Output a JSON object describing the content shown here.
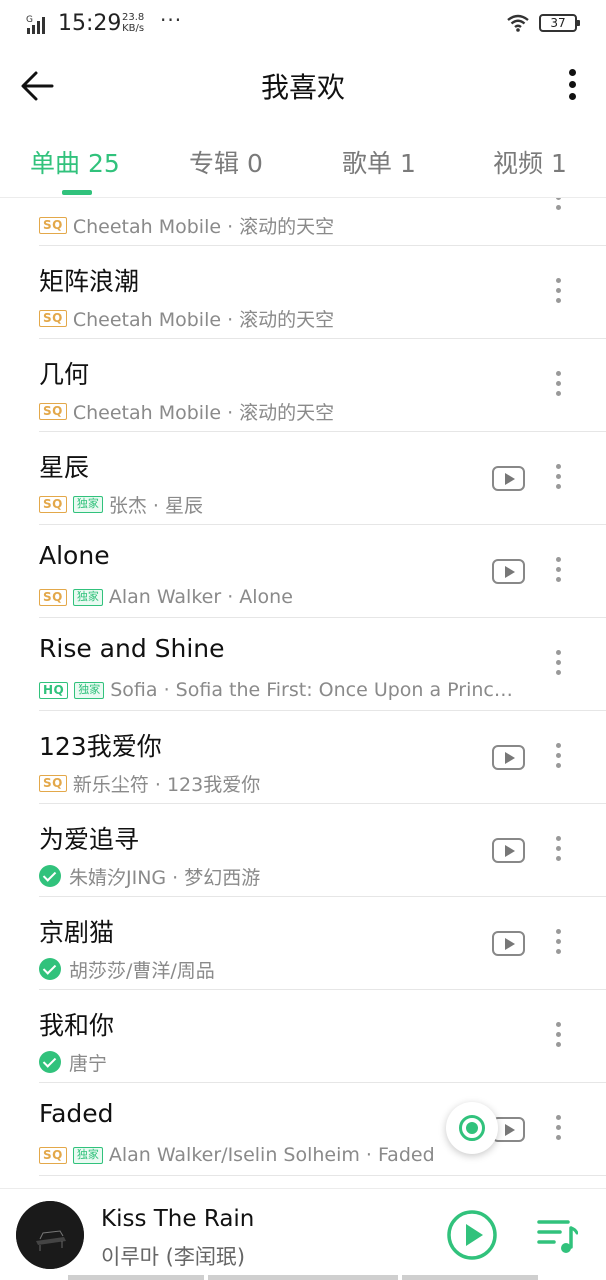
{
  "status_bar": {
    "time": "15:29",
    "network_speed_value": "23.8",
    "network_speed_unit": "KB/s",
    "signal_type": "G",
    "battery": "37",
    "extra": "···"
  },
  "header": {
    "title": "我喜欢"
  },
  "tabs": [
    {
      "label": "单曲 25",
      "active": true
    },
    {
      "label": "专辑 0",
      "active": false
    },
    {
      "label": "歌单 1",
      "active": false
    },
    {
      "label": "视频 1",
      "active": false
    }
  ],
  "songs": [
    {
      "title": "",
      "quality": "SQ",
      "exclusive": false,
      "downloaded": false,
      "sub": "Cheetah Mobile · 滚动的天空",
      "mv": false
    },
    {
      "title": "矩阵浪潮",
      "quality": "SQ",
      "exclusive": false,
      "downloaded": false,
      "sub": "Cheetah Mobile · 滚动的天空",
      "mv": false
    },
    {
      "title": "几何",
      "quality": "SQ",
      "exclusive": false,
      "downloaded": false,
      "sub": "Cheetah Mobile · 滚动的天空",
      "mv": false
    },
    {
      "title": "星辰",
      "quality": "SQ",
      "exclusive": true,
      "downloaded": false,
      "sub": "张杰 · 星辰",
      "mv": true
    },
    {
      "title": "Alone",
      "quality": "SQ",
      "exclusive": true,
      "downloaded": false,
      "sub": "Alan Walker · Alone",
      "mv": true
    },
    {
      "title": "Rise and Shine",
      "quality": "HQ",
      "exclusive": true,
      "downloaded": false,
      "sub": "Sofia · Sofia the First: Once Upon a Princ…",
      "mv": false
    },
    {
      "title": "123我爱你",
      "quality": "SQ",
      "exclusive": false,
      "downloaded": false,
      "sub": "新乐尘符 · 123我爱你",
      "mv": true
    },
    {
      "title": "为爱追寻",
      "quality": "",
      "exclusive": false,
      "downloaded": true,
      "sub": "朱婧汐JING · 梦幻西游",
      "mv": true
    },
    {
      "title": "京剧猫",
      "quality": "",
      "exclusive": false,
      "downloaded": true,
      "sub": "胡莎莎/曹洋/周品",
      "mv": true
    },
    {
      "title": "我和你",
      "quality": "",
      "exclusive": false,
      "downloaded": true,
      "sub": "唐宁",
      "mv": false
    },
    {
      "title": "Faded",
      "quality": "SQ",
      "exclusive": true,
      "downloaded": false,
      "sub": "Alan Walker/Iselin Solheim · Faded",
      "mv": true
    }
  ],
  "badges": {
    "exclusive_label": "独家"
  },
  "player": {
    "title": "Kiss The Rain",
    "artist": "이루마 (李闰珉)"
  },
  "colors": {
    "accent": "#31c27c",
    "sq_badge": "#e3a84a",
    "text_primary": "#111111",
    "text_secondary": "#8a8a8a"
  }
}
